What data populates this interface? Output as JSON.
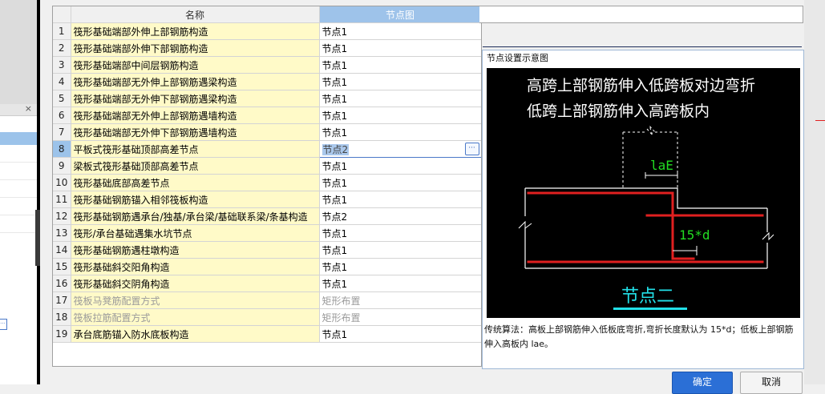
{
  "grid": {
    "columns": {
      "name": "名称",
      "node": "节点图"
    },
    "rows": [
      {
        "num": "1",
        "name": "筏形基础端部外伸上部钢筋构造",
        "value": "节点1"
      },
      {
        "num": "2",
        "name": "筏形基础端部外伸下部钢筋构造",
        "value": "节点1"
      },
      {
        "num": "3",
        "name": "筏形基础端部中间层钢筋构造",
        "value": "节点1"
      },
      {
        "num": "4",
        "name": "筏形基础端部无外伸上部钢筋遇梁构造",
        "value": "节点1"
      },
      {
        "num": "5",
        "name": "筏形基础端部无外伸下部钢筋遇梁构造",
        "value": "节点1"
      },
      {
        "num": "6",
        "name": "筏形基础端部无外伸上部钢筋遇墙构造",
        "value": "节点1"
      },
      {
        "num": "7",
        "name": "筏形基础端部无外伸下部钢筋遇墙构造",
        "value": "节点1"
      },
      {
        "num": "8",
        "name": "平板式筏形基础顶部高差节点",
        "value": "节点2"
      },
      {
        "num": "9",
        "name": "梁板式筏形基础顶部高差节点",
        "value": "节点1"
      },
      {
        "num": "10",
        "name": "筏形基础底部高差节点",
        "value": "节点1"
      },
      {
        "num": "11",
        "name": "筏形基础钢筋锚入相邻筏板构造",
        "value": "节点1"
      },
      {
        "num": "12",
        "name": "筏形基础钢筋遇承台/独基/承台梁/基础联系梁/条基构造",
        "value": "节点2"
      },
      {
        "num": "13",
        "name": "筏形/承台基础遇集水坑节点",
        "value": "节点1"
      },
      {
        "num": "14",
        "name": "筏形基础钢筋遇柱墩构造",
        "value": "节点1"
      },
      {
        "num": "15",
        "name": "筏形基础斜交阳角构造",
        "value": "节点1"
      },
      {
        "num": "16",
        "name": "筏形基础斜交阴角构造",
        "value": "节点1"
      },
      {
        "num": "17",
        "name": "筏板马凳筋配置方式",
        "value": "矩形布置"
      },
      {
        "num": "18",
        "name": "筏板拉筋配置方式",
        "value": "矩形布置"
      },
      {
        "num": "19",
        "name": "承台底筋锚入防水底板构造",
        "value": "节点1"
      }
    ],
    "ellipsis": "···"
  },
  "preview": {
    "title": "节点设置示意图",
    "diagram": {
      "line1": "高跨上部钢筋伸入低跨板对边弯折",
      "line2": "低跨上部钢筋伸入高跨板内",
      "dim_lae": "laE",
      "dim_15d": "15*d",
      "node_label": "节点二"
    },
    "description": "传统算法：高板上部钢筋伸入低板底弯折,弯折长度默认为 15*d；低板上部钢筋伸入高板内 lae。",
    "colors": {
      "canvas": "#000000",
      "rebar": "#e02020",
      "concrete": "#ffffff",
      "dim_text": "#22dd22",
      "node_label": "#22e0e8"
    }
  },
  "buttons": {
    "ok": "确定",
    "cancel": "取消"
  },
  "background": {
    "close_glyph": "×",
    "ellipsis": "···"
  }
}
